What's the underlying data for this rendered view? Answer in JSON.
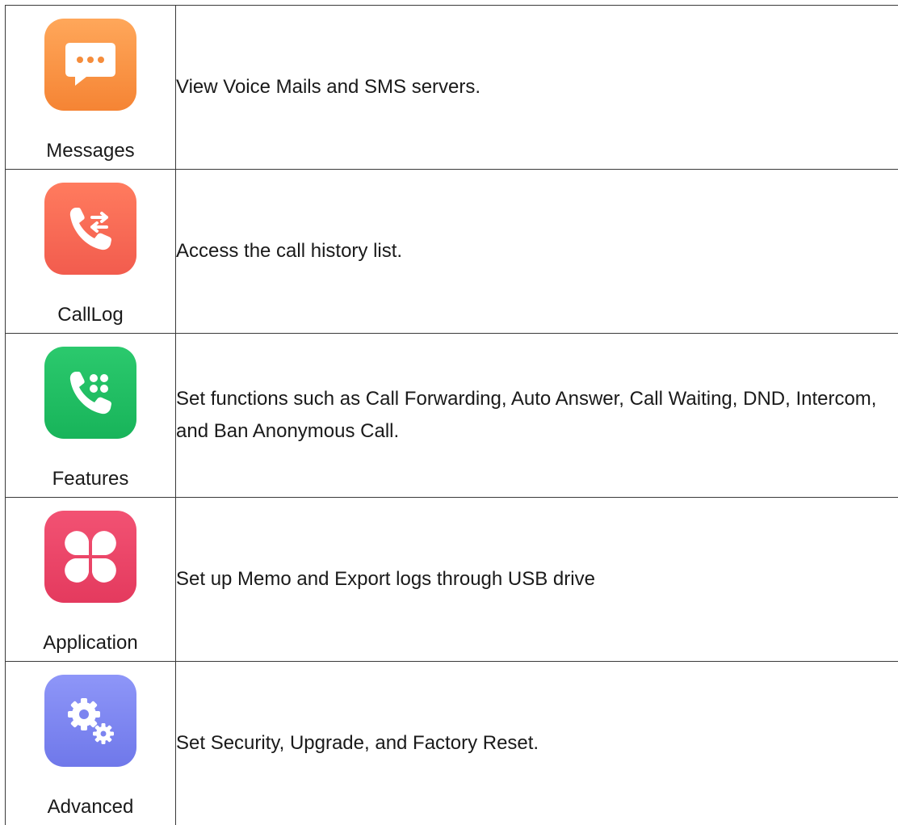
{
  "rows": [
    {
      "label": "Messages",
      "icon": "message-bubble-icon",
      "color": "#f58d3c",
      "description": "View Voice Mails and SMS servers."
    },
    {
      "label": "CallLog",
      "icon": "call-log-icon",
      "color": "#f4634f",
      "description": "Access the call history list."
    },
    {
      "label": "Features",
      "icon": "phone-features-icon",
      "color": "#1fbe63",
      "description": "Set functions such as Call Forwarding, Auto Answer, Call Waiting, DND, Intercom, and Ban Anonymous Call."
    },
    {
      "label": "Application",
      "icon": "application-clover-icon",
      "color": "#e94466",
      "description": "Set up Memo and Export logs through USB drive"
    },
    {
      "label": "Advanced",
      "icon": "gears-icon",
      "color": "#7c84f0",
      "description": "Set Security, Upgrade, and Factory Reset."
    }
  ]
}
